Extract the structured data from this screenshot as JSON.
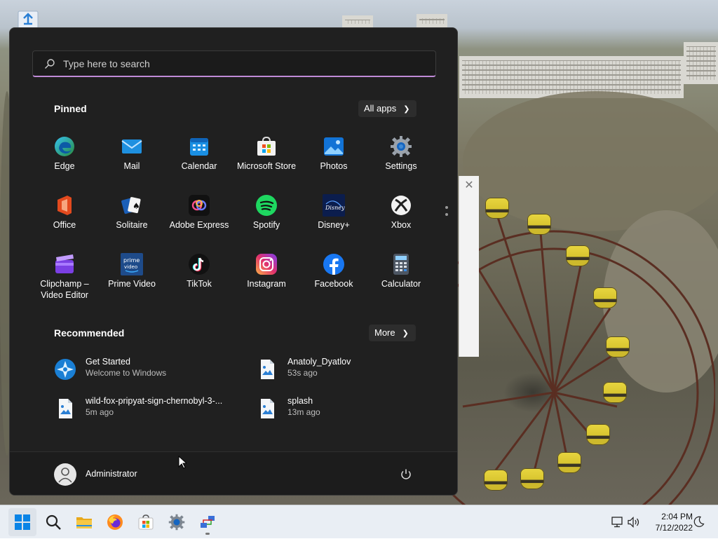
{
  "start_menu": {
    "search": {
      "placeholder": "Type here to search",
      "icon": "search-icon"
    },
    "pinned": {
      "title": "Pinned",
      "all_apps_label": "All apps",
      "apps": [
        {
          "label": "Edge",
          "icon": "edge-icon"
        },
        {
          "label": "Mail",
          "icon": "mail-icon"
        },
        {
          "label": "Calendar",
          "icon": "calendar-icon"
        },
        {
          "label": "Microsoft Store",
          "icon": "store-icon"
        },
        {
          "label": "Photos",
          "icon": "photos-icon"
        },
        {
          "label": "Settings",
          "icon": "gear-icon"
        },
        {
          "label": "Office",
          "icon": "office-icon"
        },
        {
          "label": "Solitaire",
          "icon": "cards-icon"
        },
        {
          "label": "Adobe Express",
          "icon": "adobe-express-icon"
        },
        {
          "label": "Spotify",
          "icon": "spotify-icon"
        },
        {
          "label": "Disney+",
          "icon": "disney-plus-icon"
        },
        {
          "label": "Xbox",
          "icon": "xbox-icon"
        },
        {
          "label": "Clipchamp –\nVideo Editor",
          "icon": "clipchamp-icon"
        },
        {
          "label": "Prime Video",
          "icon": "prime-video-icon"
        },
        {
          "label": "TikTok",
          "icon": "tiktok-icon"
        },
        {
          "label": "Instagram",
          "icon": "instagram-icon"
        },
        {
          "label": "Facebook",
          "icon": "facebook-icon"
        },
        {
          "label": "Calculator",
          "icon": "calculator-icon"
        }
      ]
    },
    "recommended": {
      "title": "Recommended",
      "more_label": "More",
      "items": [
        {
          "title": "Get Started",
          "subtitle": "Welcome to Windows",
          "icon": "get-started-icon"
        },
        {
          "title": "Anatoly_Dyatlov",
          "subtitle": "53s ago",
          "icon": "image-file-icon"
        },
        {
          "title": "wild-fox-pripyat-sign-chernobyl-3-...",
          "subtitle": "5m ago",
          "icon": "image-file-icon"
        },
        {
          "title": "splash",
          "subtitle": "13m ago",
          "icon": "image-file-icon"
        }
      ]
    },
    "user": {
      "name": "Administrator",
      "icon": "user-avatar-icon"
    },
    "power_icon": "power-icon"
  },
  "taskbar": {
    "apps": [
      {
        "icon": "windows-start-icon",
        "active": true
      },
      {
        "icon": "search-icon",
        "active": false
      },
      {
        "icon": "file-explorer-icon",
        "active": false
      },
      {
        "icon": "firefox-icon",
        "active": false
      },
      {
        "icon": "store-icon",
        "active": false
      },
      {
        "icon": "gear-icon",
        "active": false
      },
      {
        "icon": "network-app-icon",
        "active": false
      }
    ],
    "tray": {
      "time": "2:04 PM",
      "date": "7/12/2022",
      "icons": [
        "network-icon",
        "volume-icon",
        "notification-moon-icon"
      ]
    }
  },
  "colors": {
    "accent_underline": "#c08bd8",
    "start_bg": "#202020",
    "taskbar_bg": "#e9eef4"
  }
}
